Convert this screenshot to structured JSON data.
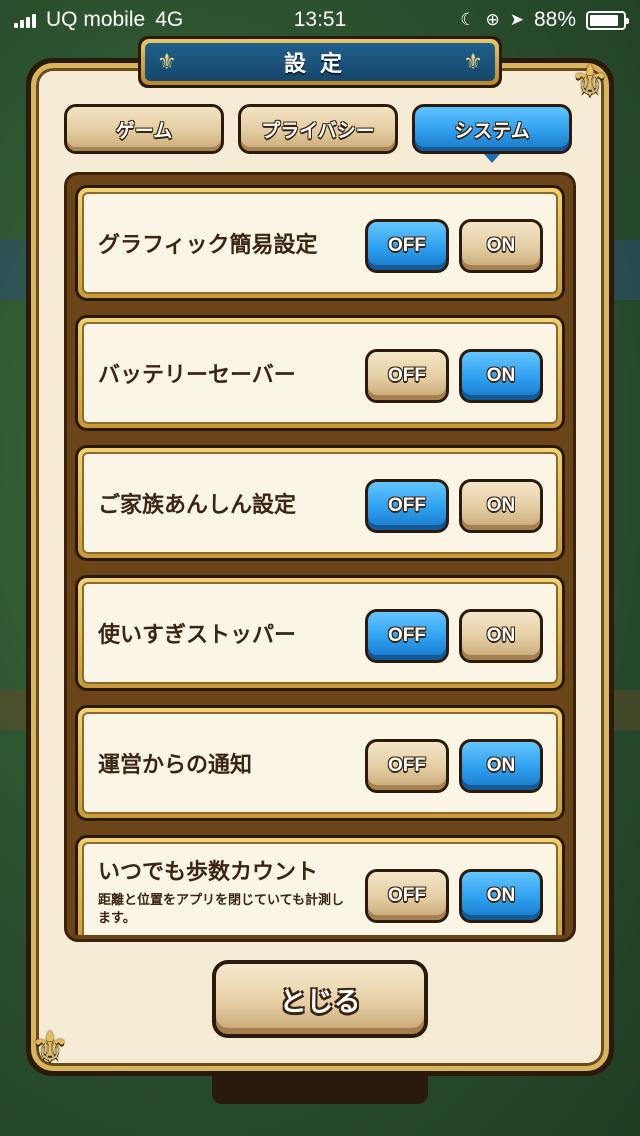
{
  "status_bar": {
    "carrier": "UQ mobile",
    "network": "4G",
    "time": "13:51",
    "battery": "88%",
    "battery_level": 0.88,
    "icons": [
      "moon-icon",
      "rotation-lock-icon",
      "location-arrow-icon"
    ]
  },
  "title": "設定",
  "tabs": [
    {
      "label": "ゲーム",
      "selected": false
    },
    {
      "label": "プライバシー",
      "selected": false
    },
    {
      "label": "システム",
      "selected": true
    }
  ],
  "settings": [
    {
      "label": "グラフィック簡易設定",
      "description": "",
      "off_label": "OFF",
      "on_label": "ON",
      "value": "OFF"
    },
    {
      "label": "バッテリーセーバー",
      "description": "",
      "off_label": "OFF",
      "on_label": "ON",
      "value": "ON"
    },
    {
      "label": "ご家族あんしん設定",
      "description": "",
      "off_label": "OFF",
      "on_label": "ON",
      "value": "OFF"
    },
    {
      "label": "使いすぎストッパー",
      "description": "",
      "off_label": "OFF",
      "on_label": "ON",
      "value": "OFF"
    },
    {
      "label": "運営からの通知",
      "description": "",
      "off_label": "OFF",
      "on_label": "ON",
      "value": "ON"
    },
    {
      "label": "いつでも歩数カウント",
      "description": "距離と位置をアプリを閉じていても計測します。",
      "off_label": "OFF",
      "on_label": "ON",
      "value": "ON"
    }
  ],
  "close_label": "とじる",
  "colors": {
    "selected_blue": "#2ea0ee",
    "button_beige": "#e4cca1",
    "frame_gold": "#d8b45a",
    "panel_cream": "#f6ecd6",
    "text_brown": "#3a2614"
  }
}
